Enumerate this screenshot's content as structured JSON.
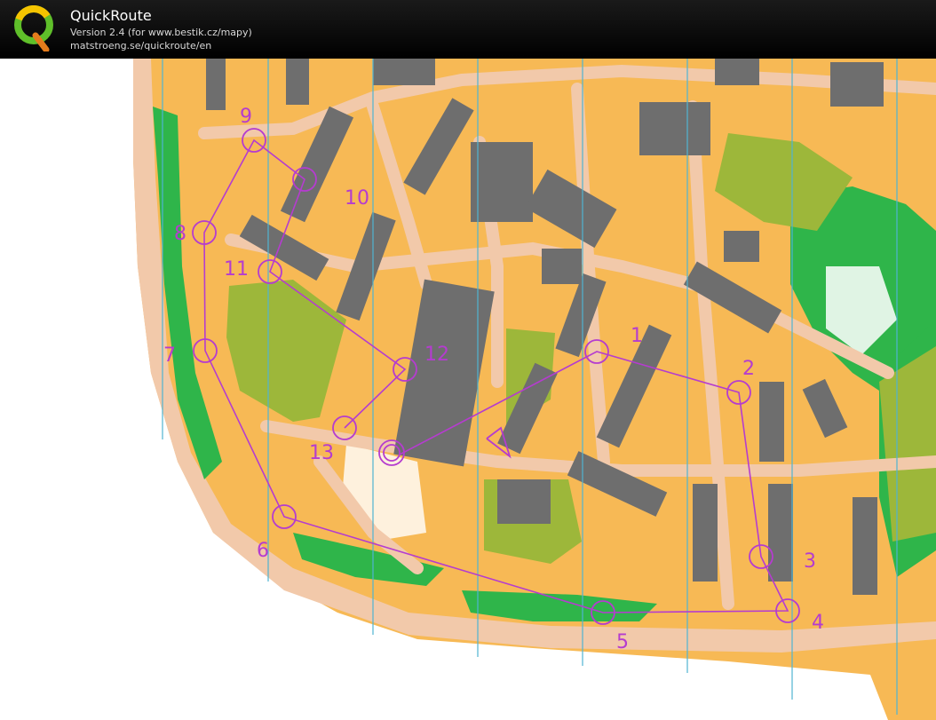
{
  "header": {
    "title": "QuickRoute",
    "version": "Version 2.4  (for www.bestik.cz/mapy)",
    "url": "matstroeng.se/quickroute/en",
    "logo_letter": "Q"
  },
  "map": {
    "controls": [
      {
        "label": "1"
      },
      {
        "label": "2"
      },
      {
        "label": "3"
      },
      {
        "label": "4"
      },
      {
        "label": "5"
      },
      {
        "label": "6"
      },
      {
        "label": "7"
      },
      {
        "label": "8"
      },
      {
        "label": "9"
      },
      {
        "label": "10"
      },
      {
        "label": "11"
      },
      {
        "label": "12"
      },
      {
        "label": "13"
      }
    ],
    "colors": {
      "open": "#f7b955",
      "forest": "#ffffff",
      "paved": "#f2c9aa",
      "green": "#2fb54a",
      "olive": "#9db73a",
      "building": "#6e6e6e",
      "course": "#b53ccf",
      "meridian": "#4fb4d1"
    }
  }
}
